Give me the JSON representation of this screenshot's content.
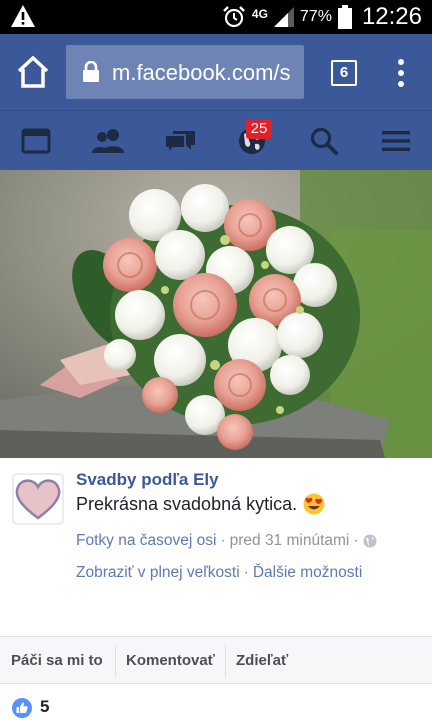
{
  "status_bar": {
    "network": "4G",
    "battery": "77%",
    "time": "12:26"
  },
  "browser": {
    "url": "m.facebook.com/s",
    "tab_count": "6"
  },
  "fb_nav": {
    "notification_count": "25"
  },
  "post": {
    "author": "Svadby podľa Ely",
    "message": "Prekrásna svadobná kytica.",
    "album_link": "Fotky na časovej osi",
    "timestamp": "pred 31 minútami",
    "separator": "·",
    "view_full_size": "Zobraziť v plnej veľkosti",
    "more_options": "Ďalšie možnosti"
  },
  "actions": {
    "like": "Páči sa mi to",
    "comment": "Komentovať",
    "share": "Zdieľať"
  },
  "reactions": {
    "like_count": "5"
  },
  "colors": {
    "facebook_blue": "#3b5998",
    "link_blue": "#5e7ab0",
    "badge_red": "#e0202a"
  }
}
